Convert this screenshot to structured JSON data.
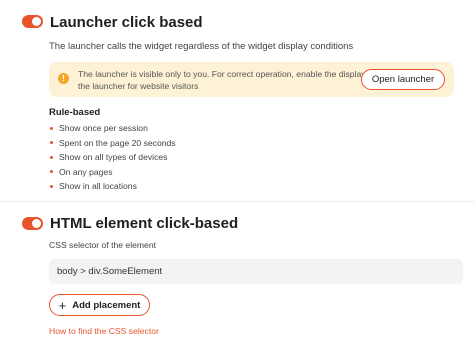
{
  "launcher_section": {
    "toggle_on": true,
    "title": "Launcher click based",
    "description": "The launcher calls the widget regardless of the widget display conditions",
    "notice": {
      "icon": "warning-icon",
      "icon_glyph": "!",
      "text": "The launcher is visible only to you. For correct operation, enable the display of the launcher for website visitors",
      "button_label": "Open launcher"
    },
    "rules_heading": "Rule-based",
    "rules": [
      "Show once per session",
      "Spent on the page 20 seconds",
      "Show on all types of devices",
      "On any pages",
      "Show in all locations"
    ]
  },
  "html_section": {
    "toggle_on": true,
    "title": "HTML element click-based",
    "selector_label": "CSS selector of the element",
    "selector_value": "body > div.SomeElement",
    "add_button_icon": "+",
    "add_button_label": "Add placement",
    "help_link": "How to find the CSS selector"
  },
  "colors": {
    "accent": "#e8542c",
    "notice_bg": "#fdf2d6",
    "warning": "#f4a62a",
    "field_bg": "#f3f3f3"
  }
}
